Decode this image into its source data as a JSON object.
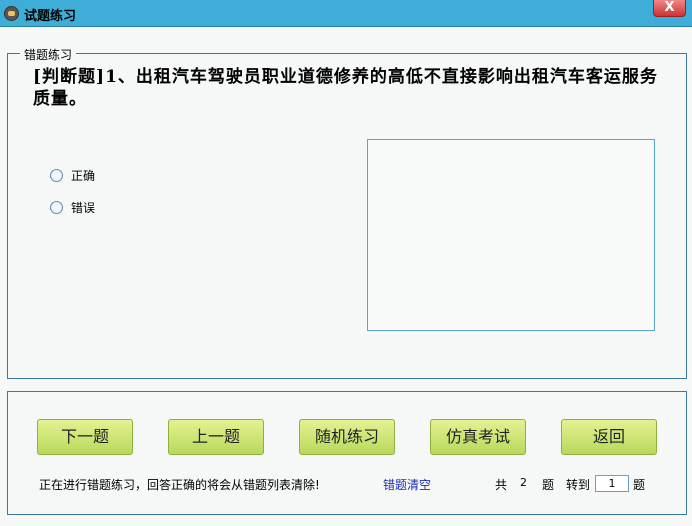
{
  "window": {
    "title": "试题练习",
    "close_label": "X"
  },
  "group": {
    "legend": "错题练习"
  },
  "question": {
    "text": "[判断题]1、出租汽车驾驶员职业道德修养的高低不直接影响出租汽车客运服务质量。",
    "options": [
      "正确",
      "错误"
    ]
  },
  "buttons": {
    "next": "下一题",
    "prev": "上一题",
    "random": "随机练习",
    "exam": "仿真考试",
    "back": "返回"
  },
  "status": {
    "message": "正在进行错题练习，回答正确的将会从错题列表清除!",
    "clear_link": "错题清空",
    "total_prefix": "共",
    "total": "2",
    "total_suffix": "题",
    "goto_label": "转到",
    "goto_value": "1",
    "goto_suffix": "题"
  }
}
